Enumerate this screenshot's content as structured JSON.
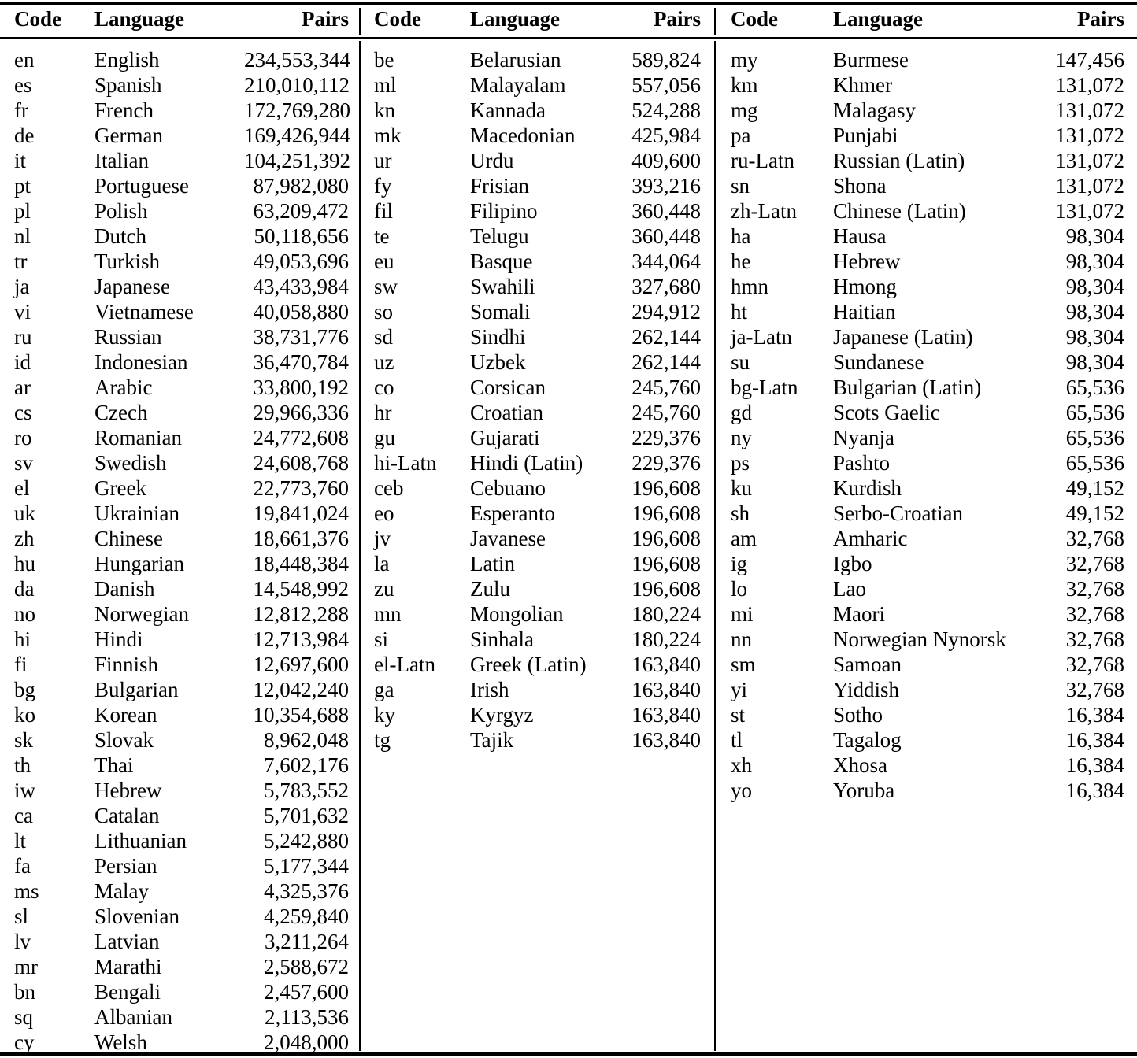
{
  "table": {
    "columns": [
      "Code",
      "Language",
      "Pairs"
    ],
    "blocks": [
      {
        "name": "block-left",
        "headers": {
          "code": "Code",
          "language": "Language",
          "pairs": "Pairs"
        },
        "rows": [
          {
            "code": "en",
            "language": "English",
            "pairs": "234,553,344"
          },
          {
            "code": "es",
            "language": "Spanish",
            "pairs": "210,010,112"
          },
          {
            "code": "fr",
            "language": "French",
            "pairs": "172,769,280"
          },
          {
            "code": "de",
            "language": "German",
            "pairs": "169,426,944"
          },
          {
            "code": "it",
            "language": "Italian",
            "pairs": "104,251,392"
          },
          {
            "code": "pt",
            "language": "Portuguese",
            "pairs": "87,982,080"
          },
          {
            "code": "pl",
            "language": "Polish",
            "pairs": "63,209,472"
          },
          {
            "code": "nl",
            "language": "Dutch",
            "pairs": "50,118,656"
          },
          {
            "code": "tr",
            "language": "Turkish",
            "pairs": "49,053,696"
          },
          {
            "code": "ja",
            "language": "Japanese",
            "pairs": "43,433,984"
          },
          {
            "code": "vi",
            "language": "Vietnamese",
            "pairs": "40,058,880"
          },
          {
            "code": "ru",
            "language": "Russian",
            "pairs": "38,731,776"
          },
          {
            "code": "id",
            "language": "Indonesian",
            "pairs": "36,470,784"
          },
          {
            "code": "ar",
            "language": "Arabic",
            "pairs": "33,800,192"
          },
          {
            "code": "cs",
            "language": "Czech",
            "pairs": "29,966,336"
          },
          {
            "code": "ro",
            "language": "Romanian",
            "pairs": "24,772,608"
          },
          {
            "code": "sv",
            "language": "Swedish",
            "pairs": "24,608,768"
          },
          {
            "code": "el",
            "language": "Greek",
            "pairs": "22,773,760"
          },
          {
            "code": "uk",
            "language": "Ukrainian",
            "pairs": "19,841,024"
          },
          {
            "code": "zh",
            "language": "Chinese",
            "pairs": "18,661,376"
          },
          {
            "code": "hu",
            "language": "Hungarian",
            "pairs": "18,448,384"
          },
          {
            "code": "da",
            "language": "Danish",
            "pairs": "14,548,992"
          },
          {
            "code": "no",
            "language": "Norwegian",
            "pairs": "12,812,288"
          },
          {
            "code": "hi",
            "language": "Hindi",
            "pairs": "12,713,984"
          },
          {
            "code": "fi",
            "language": "Finnish",
            "pairs": "12,697,600"
          },
          {
            "code": "bg",
            "language": "Bulgarian",
            "pairs": "12,042,240"
          },
          {
            "code": "ko",
            "language": "Korean",
            "pairs": "10,354,688"
          },
          {
            "code": "sk",
            "language": "Slovak",
            "pairs": "8,962,048"
          },
          {
            "code": "th",
            "language": "Thai",
            "pairs": "7,602,176"
          },
          {
            "code": "iw",
            "language": "Hebrew",
            "pairs": "5,783,552"
          },
          {
            "code": "ca",
            "language": "Catalan",
            "pairs": "5,701,632"
          },
          {
            "code": "lt",
            "language": "Lithuanian",
            "pairs": "5,242,880"
          },
          {
            "code": "fa",
            "language": "Persian",
            "pairs": "5,177,344"
          },
          {
            "code": "ms",
            "language": "Malay",
            "pairs": "4,325,376"
          },
          {
            "code": "sl",
            "language": "Slovenian",
            "pairs": "4,259,840"
          },
          {
            "code": "lv",
            "language": "Latvian",
            "pairs": "3,211,264"
          },
          {
            "code": "mr",
            "language": "Marathi",
            "pairs": "2,588,672"
          },
          {
            "code": "bn",
            "language": "Bengali",
            "pairs": "2,457,600"
          },
          {
            "code": "sq",
            "language": "Albanian",
            "pairs": "2,113,536"
          },
          {
            "code": "cy",
            "language": "Welsh",
            "pairs": "2,048,000"
          }
        ]
      },
      {
        "name": "block-middle",
        "headers": {
          "code": "Code",
          "language": "Language",
          "pairs": "Pairs"
        },
        "rows": [
          {
            "code": "be",
            "language": "Belarusian",
            "pairs": "589,824"
          },
          {
            "code": "ml",
            "language": "Malayalam",
            "pairs": "557,056"
          },
          {
            "code": "kn",
            "language": "Kannada",
            "pairs": "524,288"
          },
          {
            "code": "mk",
            "language": "Macedonian",
            "pairs": "425,984"
          },
          {
            "code": "ur",
            "language": "Urdu",
            "pairs": "409,600"
          },
          {
            "code": "fy",
            "language": "Frisian",
            "pairs": "393,216"
          },
          {
            "code": "fil",
            "language": "Filipino",
            "pairs": "360,448"
          },
          {
            "code": "te",
            "language": "Telugu",
            "pairs": "360,448"
          },
          {
            "code": "eu",
            "language": "Basque",
            "pairs": "344,064"
          },
          {
            "code": "sw",
            "language": "Swahili",
            "pairs": "327,680"
          },
          {
            "code": "so",
            "language": "Somali",
            "pairs": "294,912"
          },
          {
            "code": "sd",
            "language": "Sindhi",
            "pairs": "262,144"
          },
          {
            "code": "uz",
            "language": "Uzbek",
            "pairs": "262,144"
          },
          {
            "code": "co",
            "language": "Corsican",
            "pairs": "245,760"
          },
          {
            "code": "hr",
            "language": "Croatian",
            "pairs": "245,760"
          },
          {
            "code": "gu",
            "language": "Gujarati",
            "pairs": "229,376"
          },
          {
            "code": "hi-Latn",
            "language": "Hindi (Latin)",
            "pairs": "229,376"
          },
          {
            "code": "ceb",
            "language": "Cebuano",
            "pairs": "196,608"
          },
          {
            "code": "eo",
            "language": "Esperanto",
            "pairs": "196,608"
          },
          {
            "code": "jv",
            "language": "Javanese",
            "pairs": "196,608"
          },
          {
            "code": "la",
            "language": "Latin",
            "pairs": "196,608"
          },
          {
            "code": "zu",
            "language": "Zulu",
            "pairs": "196,608"
          },
          {
            "code": "mn",
            "language": "Mongolian",
            "pairs": "180,224"
          },
          {
            "code": "si",
            "language": "Sinhala",
            "pairs": "180,224"
          },
          {
            "code": "el-Latn",
            "language": "Greek (Latin)",
            "pairs": "163,840"
          },
          {
            "code": "ga",
            "language": "Irish",
            "pairs": "163,840"
          },
          {
            "code": "ky",
            "language": "Kyrgyz",
            "pairs": "163,840"
          },
          {
            "code": "tg",
            "language": "Tajik",
            "pairs": "163,840"
          }
        ]
      },
      {
        "name": "block-right",
        "headers": {
          "code": "Code",
          "language": "Language",
          "pairs": "Pairs"
        },
        "rows": [
          {
            "code": "my",
            "language": "Burmese",
            "pairs": "147,456"
          },
          {
            "code": "km",
            "language": "Khmer",
            "pairs": "131,072"
          },
          {
            "code": "mg",
            "language": "Malagasy",
            "pairs": "131,072"
          },
          {
            "code": "pa",
            "language": "Punjabi",
            "pairs": "131,072"
          },
          {
            "code": "ru-Latn",
            "language": "Russian (Latin)",
            "pairs": "131,072"
          },
          {
            "code": "sn",
            "language": "Shona",
            "pairs": "131,072"
          },
          {
            "code": "zh-Latn",
            "language": "Chinese (Latin)",
            "pairs": "131,072"
          },
          {
            "code": "ha",
            "language": "Hausa",
            "pairs": "98,304"
          },
          {
            "code": "he",
            "language": "Hebrew",
            "pairs": "98,304"
          },
          {
            "code": "hmn",
            "language": "Hmong",
            "pairs": "98,304"
          },
          {
            "code": "ht",
            "language": "Haitian",
            "pairs": "98,304"
          },
          {
            "code": "ja-Latn",
            "language": "Japanese (Latin)",
            "pairs": "98,304"
          },
          {
            "code": "su",
            "language": "Sundanese",
            "pairs": "98,304"
          },
          {
            "code": "bg-Latn",
            "language": "Bulgarian (Latin)",
            "pairs": "65,536"
          },
          {
            "code": "gd",
            "language": "Scots Gaelic",
            "pairs": "65,536"
          },
          {
            "code": "ny",
            "language": "Nyanja",
            "pairs": "65,536"
          },
          {
            "code": "ps",
            "language": "Pashto",
            "pairs": "65,536"
          },
          {
            "code": "ku",
            "language": "Kurdish",
            "pairs": "49,152"
          },
          {
            "code": "sh",
            "language": "Serbo-Croatian",
            "pairs": "49,152"
          },
          {
            "code": "am",
            "language": "Amharic",
            "pairs": "32,768"
          },
          {
            "code": "ig",
            "language": "Igbo",
            "pairs": "32,768"
          },
          {
            "code": "lo",
            "language": "Lao",
            "pairs": "32,768"
          },
          {
            "code": "mi",
            "language": "Maori",
            "pairs": "32,768"
          },
          {
            "code": "nn",
            "language": "Norwegian Nynorsk",
            "pairs": "32,768"
          },
          {
            "code": "sm",
            "language": "Samoan",
            "pairs": "32,768"
          },
          {
            "code": "yi",
            "language": "Yiddish",
            "pairs": "32,768"
          },
          {
            "code": "st",
            "language": "Sotho",
            "pairs": "16,384"
          },
          {
            "code": "tl",
            "language": "Tagalog",
            "pairs": "16,384"
          },
          {
            "code": "xh",
            "language": "Xhosa",
            "pairs": "16,384"
          },
          {
            "code": "yo",
            "language": "Yoruba",
            "pairs": "16,384"
          }
        ]
      }
    ]
  }
}
